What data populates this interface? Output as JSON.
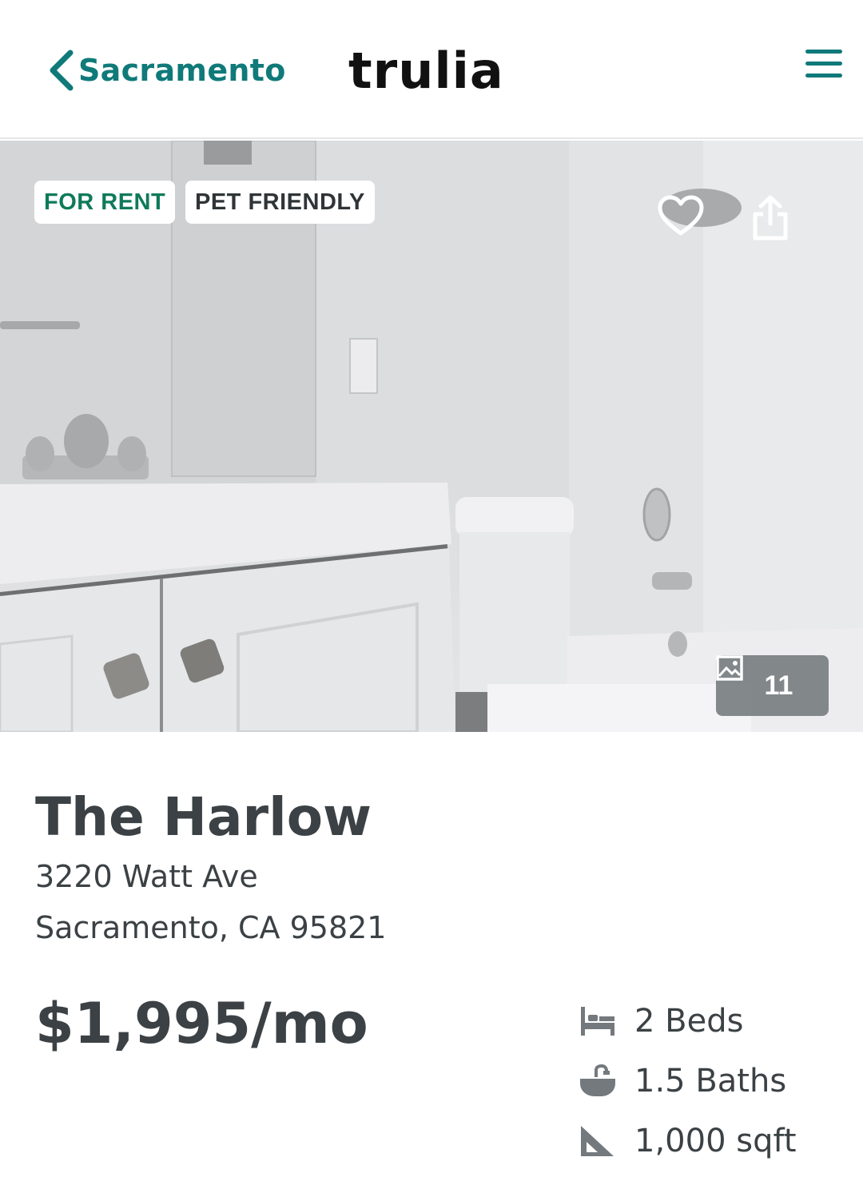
{
  "header": {
    "back_label": "Sacramento",
    "logo_text": "trulia",
    "accent_color": "#0f7a79"
  },
  "photo": {
    "tags": [
      {
        "label": "FOR RENT",
        "color": "#0f7a5a"
      },
      {
        "label": "PET FRIENDLY",
        "color": "#2f3437"
      }
    ],
    "icons": {
      "favorite": "heart-icon",
      "share": "share-icon",
      "gallery": "image-icon"
    },
    "photo_count": "11"
  },
  "listing": {
    "name": "The Harlow",
    "address_line1": "3220 Watt Ave",
    "address_line2": "Sacramento, CA 95821",
    "price": "$1,995/mo",
    "facts": [
      {
        "icon": "bed-icon",
        "label": "2 Beds"
      },
      {
        "icon": "bath-icon",
        "label": "1.5 Baths"
      },
      {
        "icon": "sqft-icon",
        "label": "1,000 sqft"
      }
    ]
  }
}
